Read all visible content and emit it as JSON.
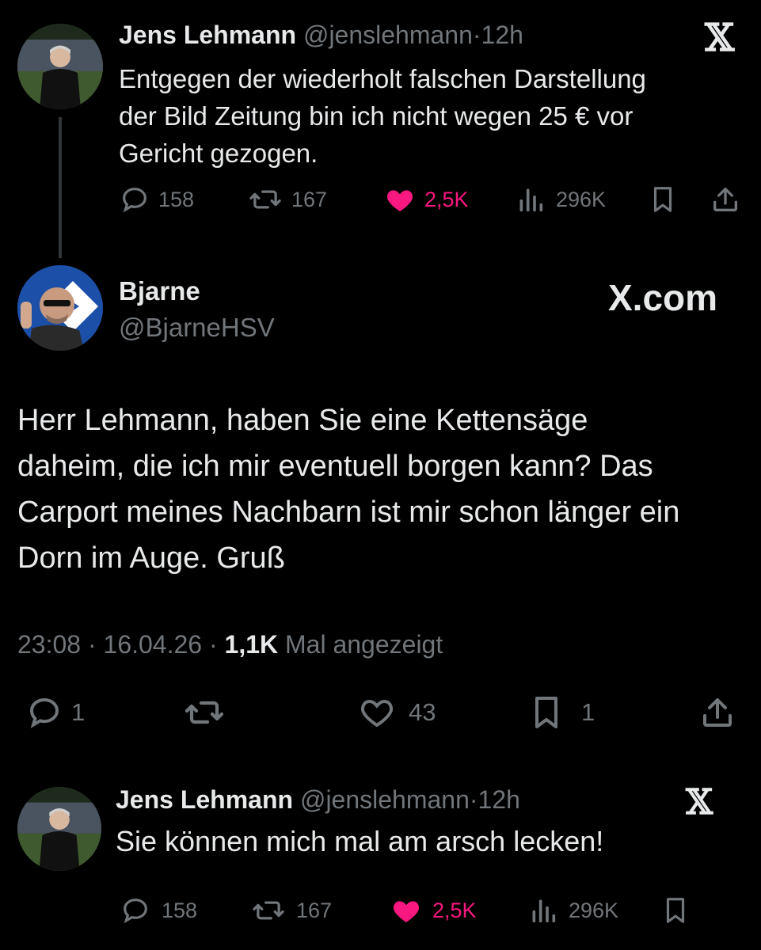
{
  "tweet1": {
    "name": "Jens Lehmann",
    "handle": "@jenslehmann",
    "sep": "·",
    "time": "12h",
    "text_lines": [
      "Entgegen der wiederholt falschen Darstellung",
      "der Bild Zeitung bin ich nicht wegen 25 € vor",
      "Gericht gezogen."
    ],
    "replies": "158",
    "reposts": "167",
    "likes": "2,5K",
    "views": "296K"
  },
  "main_tweet": {
    "name": "Bjarne",
    "handle": "@BjarneHSV",
    "brand": "X.com",
    "text_lines": [
      "Herr Lehmann, haben Sie eine Kettensäge",
      "daheim, die ich mir eventuell borgen kann? Das",
      "Carport meines Nachbarn ist mir schon länger ein",
      "Dorn im Auge. Gruß"
    ],
    "time": "23:08",
    "date": "16.04.26",
    "views_count": "1,1K",
    "views_label": "Mal angezeigt",
    "replies": "1",
    "likes": "43",
    "bookmarks": "1"
  },
  "tweet2": {
    "name": "Jens Lehmann",
    "handle": "@jenslehmann",
    "sep": "·",
    "time": "12h",
    "text": "Sie können mich mal am arsch lecken!",
    "replies": "158",
    "reposts": "167",
    "likes": "2,5K",
    "views": "296K"
  },
  "colors": {
    "background": "#000000",
    "text": "#e7e9ea",
    "muted": "#71767b",
    "like": "#f91880"
  },
  "icons": [
    "x-logo-icon",
    "reply-icon",
    "repost-icon",
    "heart-icon",
    "views-icon",
    "bookmark-icon",
    "share-icon"
  ]
}
